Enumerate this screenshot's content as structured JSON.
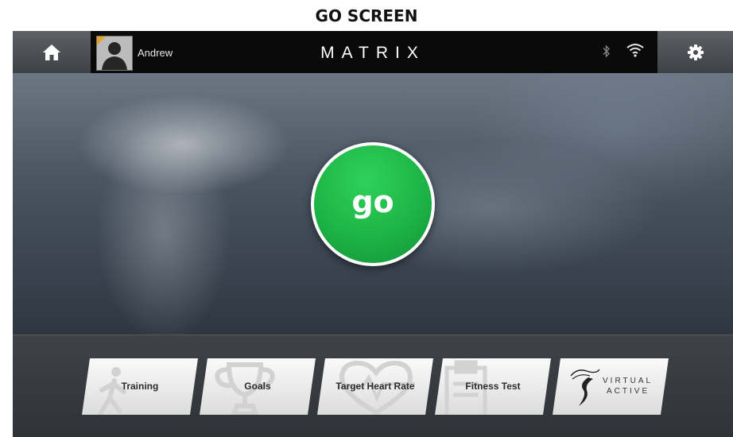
{
  "page_title": "GO SCREEN",
  "header": {
    "user_name": "Andrew",
    "brand": "MATRIX"
  },
  "main": {
    "go_label": "go"
  },
  "tiles": [
    {
      "label": "Training",
      "icon": "walking-person-icon"
    },
    {
      "label": "Goals",
      "icon": "trophy-icon"
    },
    {
      "label": "Target Heart Rate",
      "icon": "heart-icon"
    },
    {
      "label": "Fitness Test",
      "icon": "clipboard-icon"
    },
    {
      "label_line1": "VIRTUAL",
      "label_line2": "ACTIVE",
      "icon": "virtual-active-logo"
    }
  ],
  "colors": {
    "go_green": "#1db445",
    "avatar_corner": "#e9a228",
    "topbar": "#0a0a0a"
  }
}
